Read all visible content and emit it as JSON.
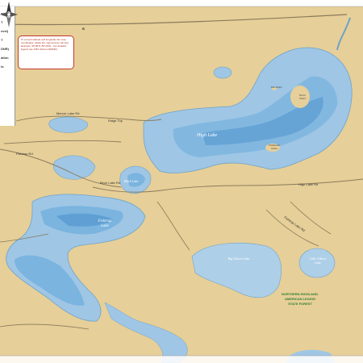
{
  "lakes": {
    "high_lake": "High Lake",
    "fishtrap_lake": "Fishtrap Lake",
    "birch_lake": "Birch Lake",
    "big_gibson_lake": "Big Gibson Lake",
    "little_gibson_lake": "Little Gibson Lake",
    "fiddlestick_island": "Fiddlestick Island",
    "pine_island": "Pine Island",
    "heron_island": "Heron Island"
  },
  "forest_label": {
    "line1": "NORTHERN HIGHLAND-",
    "line2": "AMERICAN LEGION",
    "line3": "STATE FOREST"
  },
  "legend": {
    "items": [
      "evel)",
      "T",
      "evel)",
      "T",
      "DNR)",
      "ation",
      "ts"
    ]
  },
  "roads": {
    "ridge_top": "Ridge Top",
    "mercer_lake": "Mercer Lake Rd",
    "fishtrap_rd": "Fishtrap Rd",
    "birch_lake_rd": "Birch Lake Rd",
    "high_lake_rd": "High Lake Rd",
    "fishtrap_lake_rd": "Fishtrap Lake Rd",
    "route_label": "B"
  },
  "info_box": {
    "text": "To convert latitude and longitude into map coordinates, divide the map area by cell size. Example: 45°48'N, 89°40'W... For detailed legend use 1961 Gibson (WDNR)."
  },
  "colors": {
    "land": "#e6cf98",
    "water": "#9fc6e5",
    "deep_water": "#5f9fd3",
    "road": "#8a7a5c",
    "forest_text": "#2e7d32"
  }
}
